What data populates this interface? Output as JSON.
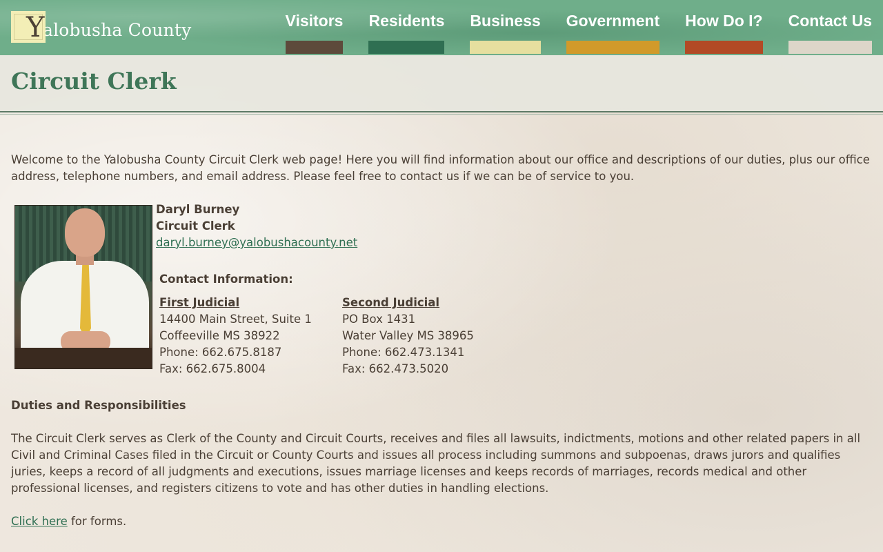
{
  "header": {
    "logo_letter": "Y",
    "logo_text": "alobusha County",
    "nav": [
      {
        "label": "Visitors",
        "color": "#5d4a3b"
      },
      {
        "label": "Residents",
        "color": "#2f6f52"
      },
      {
        "label": "Business",
        "color": "#e6df9f"
      },
      {
        "label": "Government",
        "color": "#d19a2a"
      },
      {
        "label": "How Do I?",
        "color": "#b24a25"
      },
      {
        "label": "Contact Us",
        "color": "#ddd6c9"
      }
    ]
  },
  "page": {
    "title": "Circuit Clerk",
    "intro": "Welcome to the Yalobusha County Circuit Clerk web page! Here you will find information about our office and descriptions of our duties, plus our office address, telephone numbers, and email address.  Please feel free to contact us if we can be of service to you.",
    "person": {
      "name": "Daryl Burney",
      "title": "Circuit Clerk",
      "email": "daryl.burney@yalobushacounty.net"
    },
    "contact_heading": "Contact Information:",
    "offices": [
      {
        "heading": "First Judicial",
        "line1": "14400 Main Street, Suite 1",
        "line2": "Coffeeville MS 38922",
        "phone": "Phone: 662.675.8187",
        "fax": "Fax: 662.675.8004"
      },
      {
        "heading": "Second Judicial",
        "line1": "PO Box 1431",
        "line2": "Water Valley MS 38965",
        "phone": "Phone: 662.473.1341",
        "fax": "Fax: 662.473.5020"
      }
    ],
    "duties_heading": "Duties and Responsibilities",
    "duties_text": "The Circuit Clerk serves as Clerk of the County and Circuit Courts, receives and files all lawsuits, indictments, motions and other related papers in all Civil and Criminal Cases filed in the Circuit or County Courts and issues all process including summons and subpoenas, draws jurors and qualifies juries, keeps a record of all judgments and executions, issues marriage licenses and keeps records of marriages, records medical and other professional licenses, and registers citizens to vote and has other duties in handling elections.",
    "forms_link": "Click here",
    "forms_suffix": " for forms."
  }
}
